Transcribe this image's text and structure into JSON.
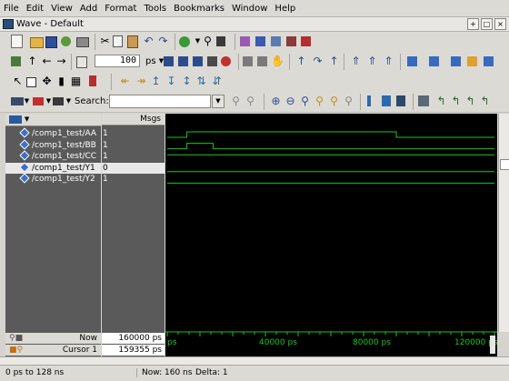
{
  "menu": [
    "File",
    "Edit",
    "View",
    "Add",
    "Format",
    "Tools",
    "Bookmarks",
    "Window",
    "Help"
  ],
  "window": {
    "title": "Wave - Default"
  },
  "toolbar": {
    "time_step_value": "100",
    "time_step_unit": "ps",
    "search_label": "Search:"
  },
  "signals_header": {
    "msgs_label": "Msgs"
  },
  "signals": [
    {
      "name": "/comp1_test/AA",
      "value": "1",
      "selected": false,
      "waveform": [
        [
          0,
          0
        ],
        [
          6,
          0
        ],
        [
          6,
          1
        ],
        [
          70,
          1
        ],
        [
          70,
          0
        ],
        [
          100,
          0
        ]
      ]
    },
    {
      "name": "/comp1_test/BB",
      "value": "1",
      "selected": false,
      "waveform": [
        [
          0,
          0
        ],
        [
          6,
          0
        ],
        [
          6,
          1
        ],
        [
          14,
          1
        ],
        [
          14,
          0
        ],
        [
          100,
          0
        ]
      ]
    },
    {
      "name": "/comp1_test/CC",
      "value": "1",
      "selected": false,
      "waveform": [
        [
          0,
          1
        ],
        [
          100,
          1
        ]
      ]
    },
    {
      "name": "/comp1_test/Y1",
      "value": "0",
      "selected": true,
      "waveform": [
        [
          0,
          0
        ],
        [
          100,
          0
        ]
      ]
    },
    {
      "name": "/comp1_test/Y2",
      "value": "1",
      "selected": false,
      "waveform": [
        [
          0,
          0
        ],
        [
          100,
          0
        ]
      ]
    }
  ],
  "footer": {
    "now_label": "Now",
    "now_value": "160000 ps",
    "cursor_label": "Cursor 1",
    "cursor_value": "159355 ps",
    "time_axis_ticks": [
      "ps",
      "40000 ps",
      "80000 ps",
      "120000 ps"
    ]
  },
  "status": {
    "range": "0 ps to 128 ns",
    "now": "Now: 160 ns",
    "delta": "Delta: 1"
  },
  "colors": {
    "wave": "#19c819",
    "background": "#000000",
    "cursor": "#e6e6e6"
  }
}
